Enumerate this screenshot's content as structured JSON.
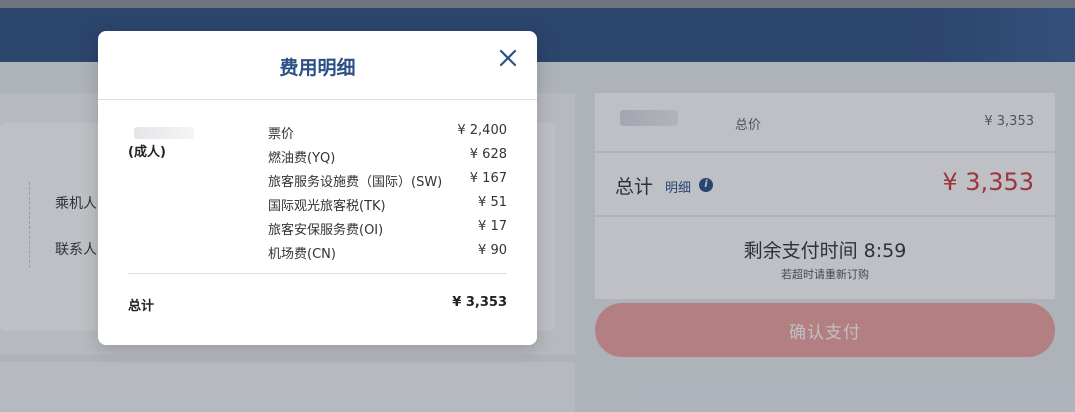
{
  "page": {
    "passenger_label": "乘机人",
    "contact_label": "联系人",
    "summary": {
      "price_label": "总价",
      "price_value": "¥ 3,353",
      "total_label": "总计",
      "detail_link": "明细",
      "total_value": "¥ 3,353",
      "timer_text": "剩余支付时间 8:59",
      "timer_note": "若超时请重新订购",
      "pay_button": "确认支付"
    }
  },
  "modal": {
    "title": "费用明细",
    "passenger_type": "(成人)",
    "fees": [
      {
        "name": "票价",
        "value": "¥ 2,400"
      },
      {
        "name": "燃油费(YQ)",
        "value": "¥ 628"
      },
      {
        "name": "旅客服务设施费（国际）(SW)",
        "value": "¥ 167"
      },
      {
        "name": "国际观光旅客税(TK)",
        "value": "¥ 51"
      },
      {
        "name": "旅客安保服务费(OI)",
        "value": "¥ 17"
      },
      {
        "name": "机场费(CN)",
        "value": "¥ 90"
      }
    ],
    "total_label": "总计",
    "total_value": "¥ 3,353"
  },
  "colors": {
    "header": "#2f4f82",
    "accent_red": "#d0383d",
    "pay_button": "#efa39f",
    "link_blue": "#2b4f86"
  }
}
